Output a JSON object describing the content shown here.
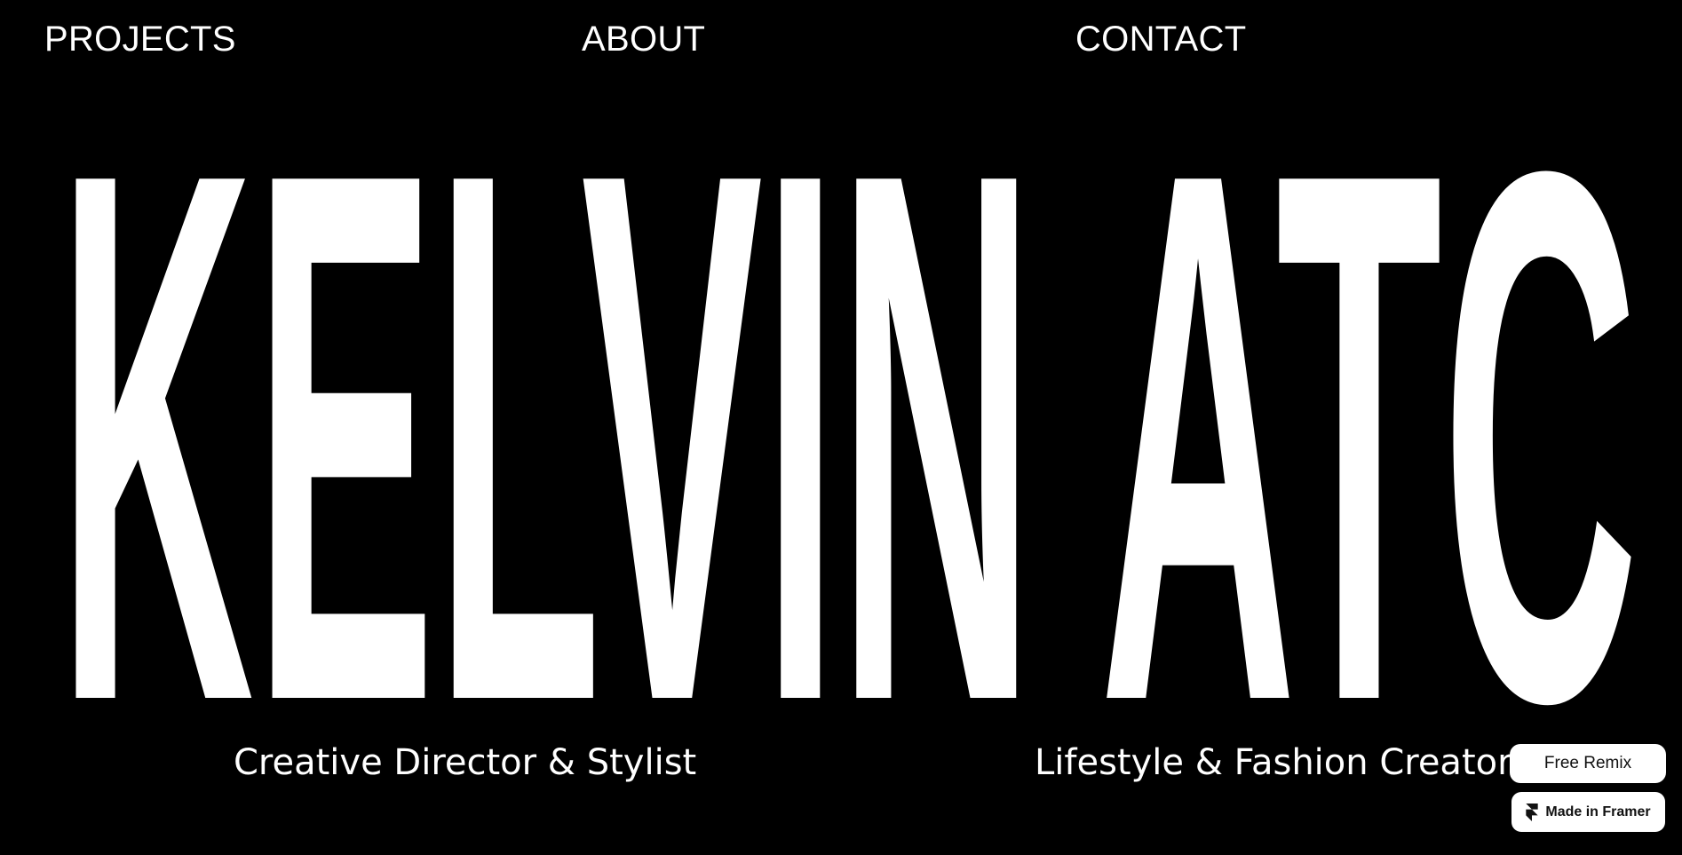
{
  "nav": {
    "projects": "PROJECTS",
    "about": "ABOUT",
    "contact": "CONTACT"
  },
  "hero": {
    "title": "KELVIN ATC"
  },
  "taglines": {
    "left": "Creative Director & Stylist",
    "right": "Lifestyle & Fashion Creator"
  },
  "badges": {
    "remix": "Free Remix",
    "framer": "Made in Framer",
    "framer_icon": "framer-logo-icon"
  },
  "colors": {
    "background": "#000000",
    "foreground": "#ffffff"
  }
}
